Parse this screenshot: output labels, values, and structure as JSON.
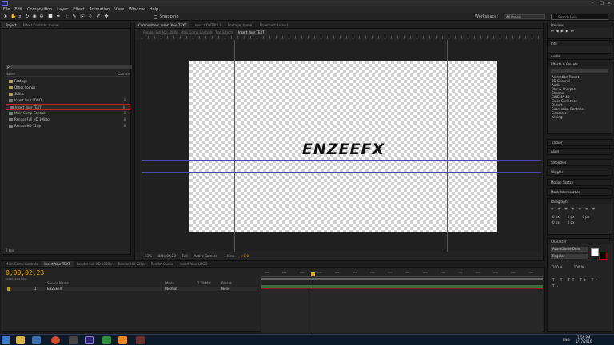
{
  "menu": [
    "File",
    "Edit",
    "Composition",
    "Layer",
    "Effect",
    "Animation",
    "View",
    "Window",
    "Help"
  ],
  "toolbar": {
    "snapping": "Snapping",
    "workspace_label": "Workspace:",
    "workspace_value": "All Panels",
    "search_placeholder": "Search Help"
  },
  "project": {
    "tabs": [
      "Project",
      "Effect Controls: (none)"
    ],
    "search": "ρ▾",
    "col_name": "Name",
    "col_comment": "Comme",
    "items": [
      {
        "name": "Footage",
        "bpc": "",
        "folder": true
      },
      {
        "name": "Other Comps",
        "bpc": "",
        "folder": true
      },
      {
        "name": "Solids",
        "bpc": "",
        "folder": true
      },
      {
        "name": "Insert Your LOGO",
        "bpc": "8",
        "folder": false
      },
      {
        "name": "Insert Your TEXT",
        "bpc": "8",
        "folder": false
      },
      {
        "name": "Main Comp Controls",
        "bpc": "8",
        "folder": false
      },
      {
        "name": "Render Full HD 1080p",
        "bpc": "8",
        "folder": false
      },
      {
        "name": "Render HD 720p",
        "bpc": "8",
        "folder": false
      }
    ],
    "bpc_label": "8 bpc"
  },
  "comp": {
    "tabs": [
      "Composition: Insert Your TEXT",
      "Layer: CONTROLS",
      "Footage: (none)",
      "Flowchart: (none)"
    ],
    "subtabs": [
      "Render Full HD 1080p",
      "Main Comp Controls",
      "Text Effects",
      "Insert Your TEXT"
    ],
    "brand_text": "ENZEEFX",
    "zoom": "33%",
    "time": "0;00;02;23",
    "resolution": "Full",
    "camera": "Active Camera",
    "view": "1 View",
    "exposure": "+0.0"
  },
  "right": {
    "preview": "Preview",
    "info": "Info",
    "audio": "Audio",
    "effects": "Effects & Presets",
    "effects_list": [
      "Animation Presets",
      "3D Channel",
      "Audio",
      "Blur & Sharpen",
      "Channel",
      "CINEMA 4D",
      "Color Correction",
      "Distort",
      "Expression Controls",
      "Generate",
      "Keying"
    ],
    "tracker": "Tracker",
    "align": "Align",
    "smoother": "Smoother",
    "wiggler": "Wiggler",
    "motion_sketch": "Motion Sketch",
    "mask_interp": "Mask Interpolation",
    "paragraph": "Paragraph",
    "character": "Character",
    "font": "AvantGarde Demi",
    "font_style": "Regular",
    "px_values": [
      "0 px",
      "0 px",
      "0 px",
      "0 px",
      "0 px"
    ],
    "scale_values": [
      "100 %",
      "100 %"
    ]
  },
  "timeline": {
    "tabs": [
      "Main Comp Controls",
      "Insert Your TEXT",
      "Render Full HD 1080p",
      "Render HD 720p",
      "Render Queue",
      "Insert Your LOGO"
    ],
    "timecode": "0;00;02;23",
    "fps": "00083 (29.97 fps)",
    "columns": [
      "Source Name",
      "Mode",
      "T TrkMat",
      "Parent"
    ],
    "layer": {
      "num": "1",
      "name": "ENZEEFX",
      "mode": "Normal",
      "parent": "None"
    },
    "ruler_ticks": [
      "00s",
      "01s",
      "02s",
      "03s",
      "04s",
      "05s",
      "06s",
      "07s",
      "08s",
      "09s",
      "10s",
      "11s",
      "12s",
      "13s",
      "14s",
      "15s"
    ]
  },
  "taskbar": {
    "lang": "ENG",
    "time": "1:56 PM",
    "date": "1/17/2016"
  },
  "colors": {
    "accent": "#e0b000",
    "selection": "#c0202a",
    "guide": "#4a4aaa"
  }
}
